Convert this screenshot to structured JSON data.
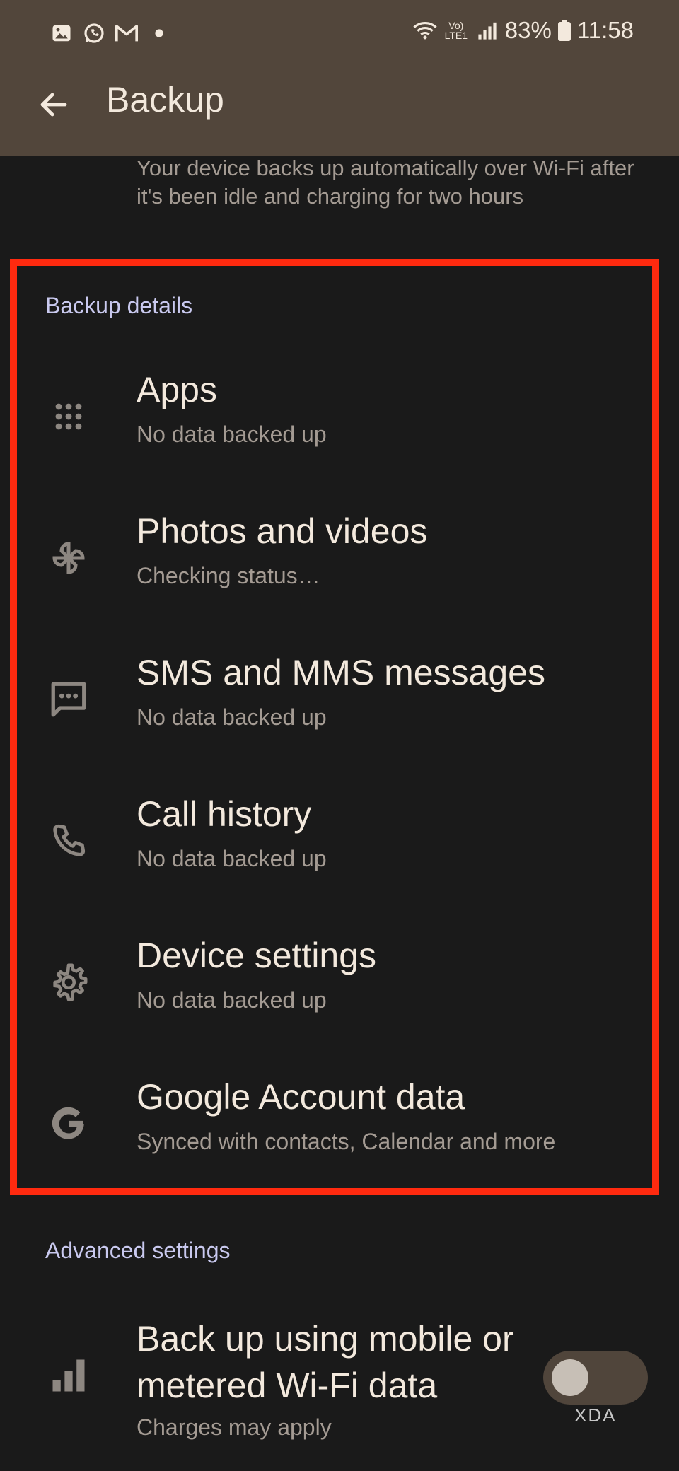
{
  "status_bar": {
    "battery": "83%",
    "time": "11:58",
    "network_badge": "Vo) LTE1",
    "left_icons": [
      "gallery-icon",
      "whatsapp-icon",
      "gmail-icon",
      "dot-icon"
    ]
  },
  "app_bar": {
    "title": "Backup"
  },
  "top_description": "Your device backs up automatically over Wi-Fi after it's been idle and charging for two hours",
  "backup_details": {
    "section_title": "Backup details",
    "items": [
      {
        "icon": "apps-grid-icon",
        "title": "Apps",
        "subtitle": "No data backed up"
      },
      {
        "icon": "pinwheel-icon",
        "title": "Photos and videos",
        "subtitle": "Checking status…"
      },
      {
        "icon": "message-icon",
        "title": "SMS and MMS messages",
        "subtitle": "No data backed up"
      },
      {
        "icon": "phone-icon",
        "title": "Call history",
        "subtitle": "No data backed up"
      },
      {
        "icon": "gear-icon",
        "title": "Device settings",
        "subtitle": "No data backed up"
      },
      {
        "icon": "google-icon",
        "title": "Google Account data",
        "subtitle": "Synced with contacts, Calendar and more"
      }
    ]
  },
  "advanced": {
    "section_title": "Advanced settings",
    "mobile_data": {
      "icon": "signal-bars-icon",
      "title": "Back up using mobile or metered Wi-Fi data",
      "subtitle": "Charges may apply",
      "enabled": false
    }
  },
  "watermark": "XDA",
  "colors": {
    "app_bar": "#52463b",
    "background": "#1a1a1a",
    "highlight_border": "#ff2a0f",
    "section_title": "#c9c9ef"
  }
}
